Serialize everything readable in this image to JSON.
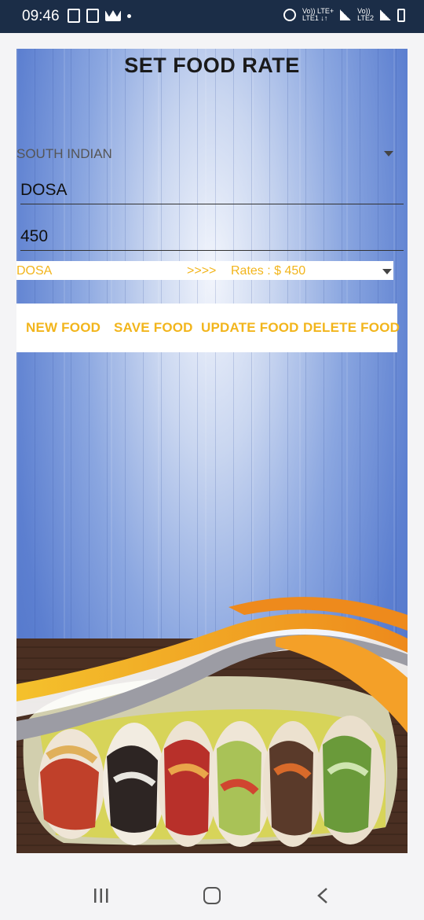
{
  "status_bar": {
    "time": "09:46",
    "network_line1": "Vo)) LTE+",
    "network_line2": "LTE1 ↓↑",
    "network2_line1": "Vo))",
    "network2_line2": "LTE2"
  },
  "page": {
    "title": "SET FOOD RATE"
  },
  "category": {
    "selected": "SOUTH INDIAN"
  },
  "food_name": {
    "value": "DOSA"
  },
  "rate": {
    "value": "450"
  },
  "food_list": {
    "selected_name": "DOSA",
    "separator": ">>>>",
    "rate_text": "Rates : $ 450"
  },
  "buttons": {
    "new": "NEW FOOD",
    "save": "SAVE FOOD",
    "update": "UPDATE FOOD",
    "delete": "DELETE FOOD"
  },
  "colors": {
    "status_bar": "#1b2d47",
    "accent": "#f2b51c",
    "nav_bar": "#f4f4f6"
  },
  "nav": {
    "recents": "recents-icon",
    "home": "home-icon",
    "back": "back-icon"
  }
}
